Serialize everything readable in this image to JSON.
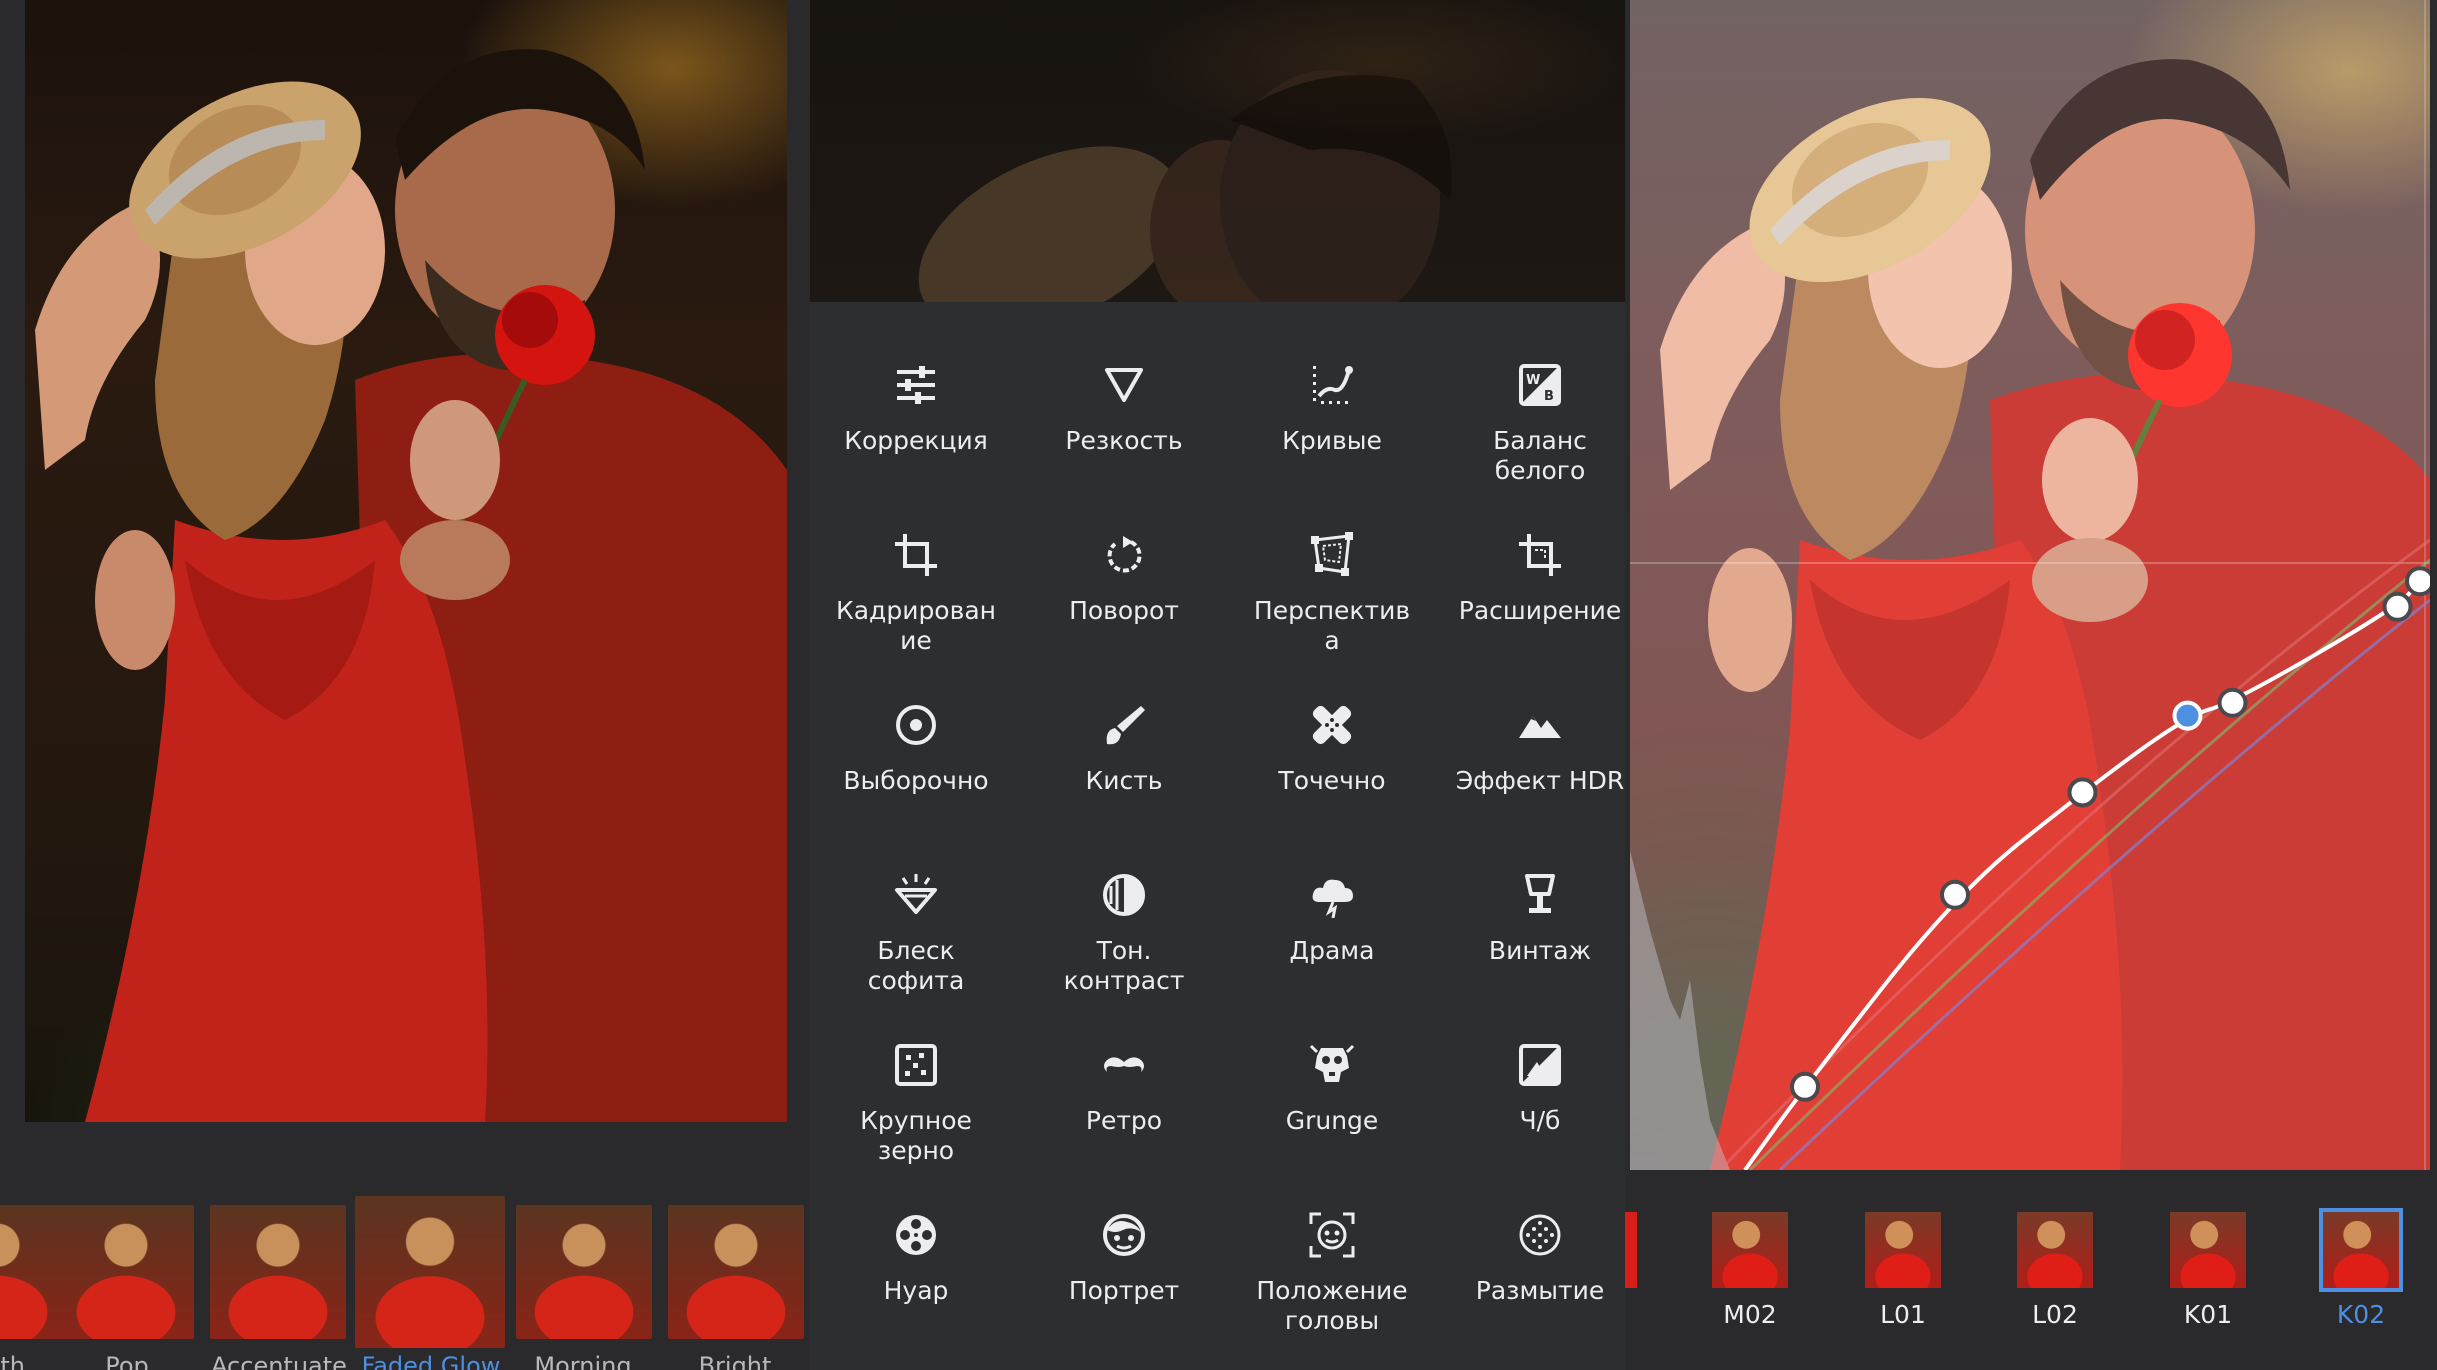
{
  "left_panel": {
    "filters": [
      {
        "label": "th",
        "selected": false
      },
      {
        "label": "Pop",
        "selected": false
      },
      {
        "label": "Accentuate",
        "selected": false
      },
      {
        "label": "Faded Glow",
        "selected": true
      },
      {
        "label": "Morning",
        "selected": false
      },
      {
        "label": "Bright",
        "selected": false
      }
    ]
  },
  "tools": [
    {
      "label": "Коррекция",
      "icon": "tune-sliders-icon"
    },
    {
      "label": "Резкость",
      "icon": "triangle-down-icon"
    },
    {
      "label": "Кривые",
      "icon": "curves-icon"
    },
    {
      "label": "Баланс\nбелого",
      "icon": "white-balance-icon"
    },
    {
      "label": "Кадрирован\nие",
      "icon": "crop-icon"
    },
    {
      "label": "Поворот",
      "icon": "rotate-icon"
    },
    {
      "label": "Перспектив\nа",
      "icon": "perspective-icon"
    },
    {
      "label": "Расширение",
      "icon": "expand-icon"
    },
    {
      "label": "Выборочно",
      "icon": "selective-icon"
    },
    {
      "label": "Кисть",
      "icon": "brush-icon"
    },
    {
      "label": "Точечно",
      "icon": "healing-icon"
    },
    {
      "label": "Эффект HDR",
      "icon": "hdr-mountain-icon"
    },
    {
      "label": "Блеск\nсофита",
      "icon": "glamour-glow-icon"
    },
    {
      "label": "Тон.\nконтраст",
      "icon": "tonal-contrast-icon"
    },
    {
      "label": "Драма",
      "icon": "drama-cloud-icon"
    },
    {
      "label": "Винтаж",
      "icon": "vintage-lamp-icon"
    },
    {
      "label": "Крупное\nзерно",
      "icon": "grainy-film-icon"
    },
    {
      "label": "Ретро",
      "icon": "retro-mustache-icon"
    },
    {
      "label": "Grunge",
      "icon": "grunge-icon"
    },
    {
      "label": "Ч/б",
      "icon": "black-white-icon"
    },
    {
      "label": "Нуар",
      "icon": "noir-reel-icon"
    },
    {
      "label": "Портрет",
      "icon": "portrait-face-icon"
    },
    {
      "label": "Положение\nголовы",
      "icon": "head-pose-icon"
    },
    {
      "label": "Размытие",
      "icon": "lens-blur-icon"
    }
  ],
  "right_panel": {
    "curve_points": [
      [
        0.1,
        0.0
      ],
      [
        0.18,
        0.13
      ],
      [
        0.38,
        0.43
      ],
      [
        0.55,
        0.59
      ],
      [
        0.69,
        0.71
      ],
      [
        0.75,
        0.73
      ],
      [
        0.97,
        0.88
      ],
      [
        1.0,
        0.92
      ]
    ],
    "curve_selected_index": 4,
    "presets": [
      {
        "label": "M02",
        "selected": false
      },
      {
        "label": "L01",
        "selected": false
      },
      {
        "label": "L02",
        "selected": false
      },
      {
        "label": "K01",
        "selected": false
      },
      {
        "label": "K02",
        "selected": true
      }
    ]
  },
  "colors": {
    "accent": "#4d8fe0",
    "panel": "#2d2e30",
    "text": "#ededf0",
    "label_muted": "#b8b8bc"
  }
}
